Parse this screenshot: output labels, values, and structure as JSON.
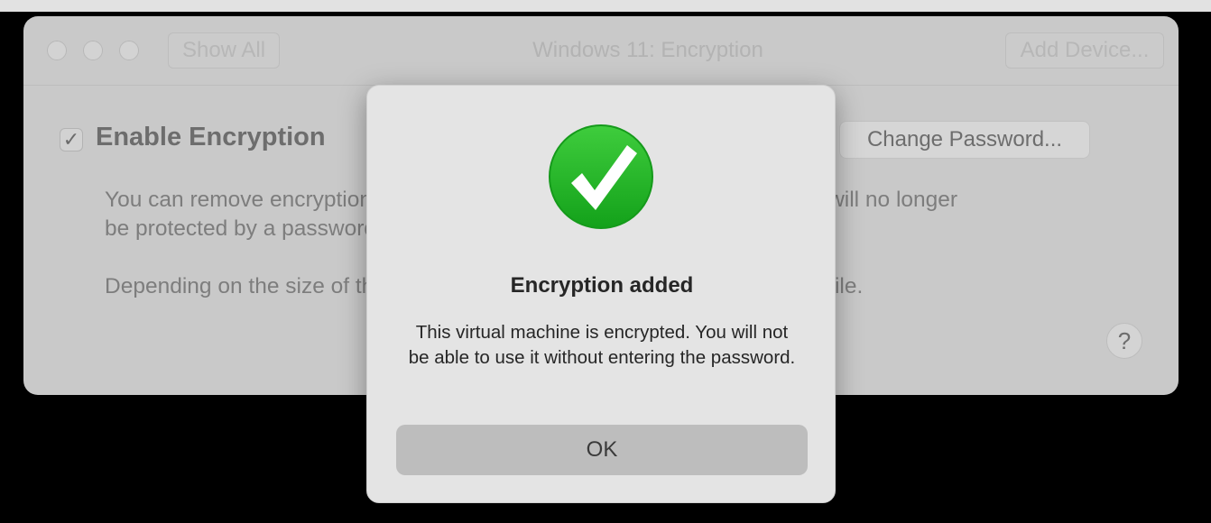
{
  "window": {
    "title": "Windows 11: Encryption",
    "show_all_label": "Show All",
    "add_device_label": "Add Device..."
  },
  "encryption": {
    "checkbox_mark": "✓",
    "enable_label": "Enable Encryption",
    "enabled": true,
    "change_password_label": "Change Password...",
    "para1_line1": "You can remove encryption from this virtual machine. The virtual machine will no longer",
    "para1_line2": "be protected by a password.",
    "para2": "Depending on the size of the virtual machine, this operation may take a while.",
    "help_label": "?"
  },
  "alert": {
    "icon": "checkmark-circle-icon",
    "title": "Encryption added",
    "message": "This virtual machine is encrypted. You will not be able to use it without entering the password.",
    "ok_label": "OK"
  },
  "colors": {
    "success_green": "#22b626",
    "dialog_bg": "#e4e4e4",
    "dimmed_window": "#c9c9c9"
  }
}
